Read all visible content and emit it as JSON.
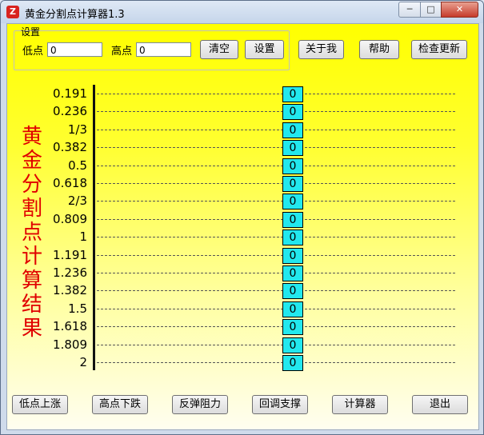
{
  "window": {
    "title": "黄金分割点计算器1.3",
    "app_icon_glyph": "Z",
    "minimize_glyph": "─",
    "maximize_glyph": "□",
    "close_glyph": "✕"
  },
  "settings": {
    "group_label": "设置",
    "low_label": "低点",
    "low_value": "0",
    "high_label": "高点",
    "high_value": "0"
  },
  "toolbar": {
    "clear": "清空",
    "settings": "设置",
    "about": "关于我",
    "help": "帮助",
    "update": "检查更新"
  },
  "result_title": "黄金分割点计算结果",
  "rows": [
    {
      "ratio": "0.191",
      "value": "0"
    },
    {
      "ratio": "0.236",
      "value": "0"
    },
    {
      "ratio": "1/3",
      "value": "0"
    },
    {
      "ratio": "0.382",
      "value": "0"
    },
    {
      "ratio": "0.5",
      "value": "0"
    },
    {
      "ratio": "0.618",
      "value": "0"
    },
    {
      "ratio": "2/3",
      "value": "0"
    },
    {
      "ratio": "0.809",
      "value": "0"
    },
    {
      "ratio": "1",
      "value": "0"
    },
    {
      "ratio": "1.191",
      "value": "0"
    },
    {
      "ratio": "1.236",
      "value": "0"
    },
    {
      "ratio": "1.382",
      "value": "0"
    },
    {
      "ratio": "1.5",
      "value": "0"
    },
    {
      "ratio": "1.618",
      "value": "0"
    },
    {
      "ratio": "1.809",
      "value": "0"
    },
    {
      "ratio": "2",
      "value": "0"
    }
  ],
  "bottom_buttons": {
    "low_rise": "低点上涨",
    "high_fall": "高点下跌",
    "rebound": "反弹阻力",
    "pullback": "回调支撑",
    "calculator": "计算器",
    "exit": "退出"
  }
}
